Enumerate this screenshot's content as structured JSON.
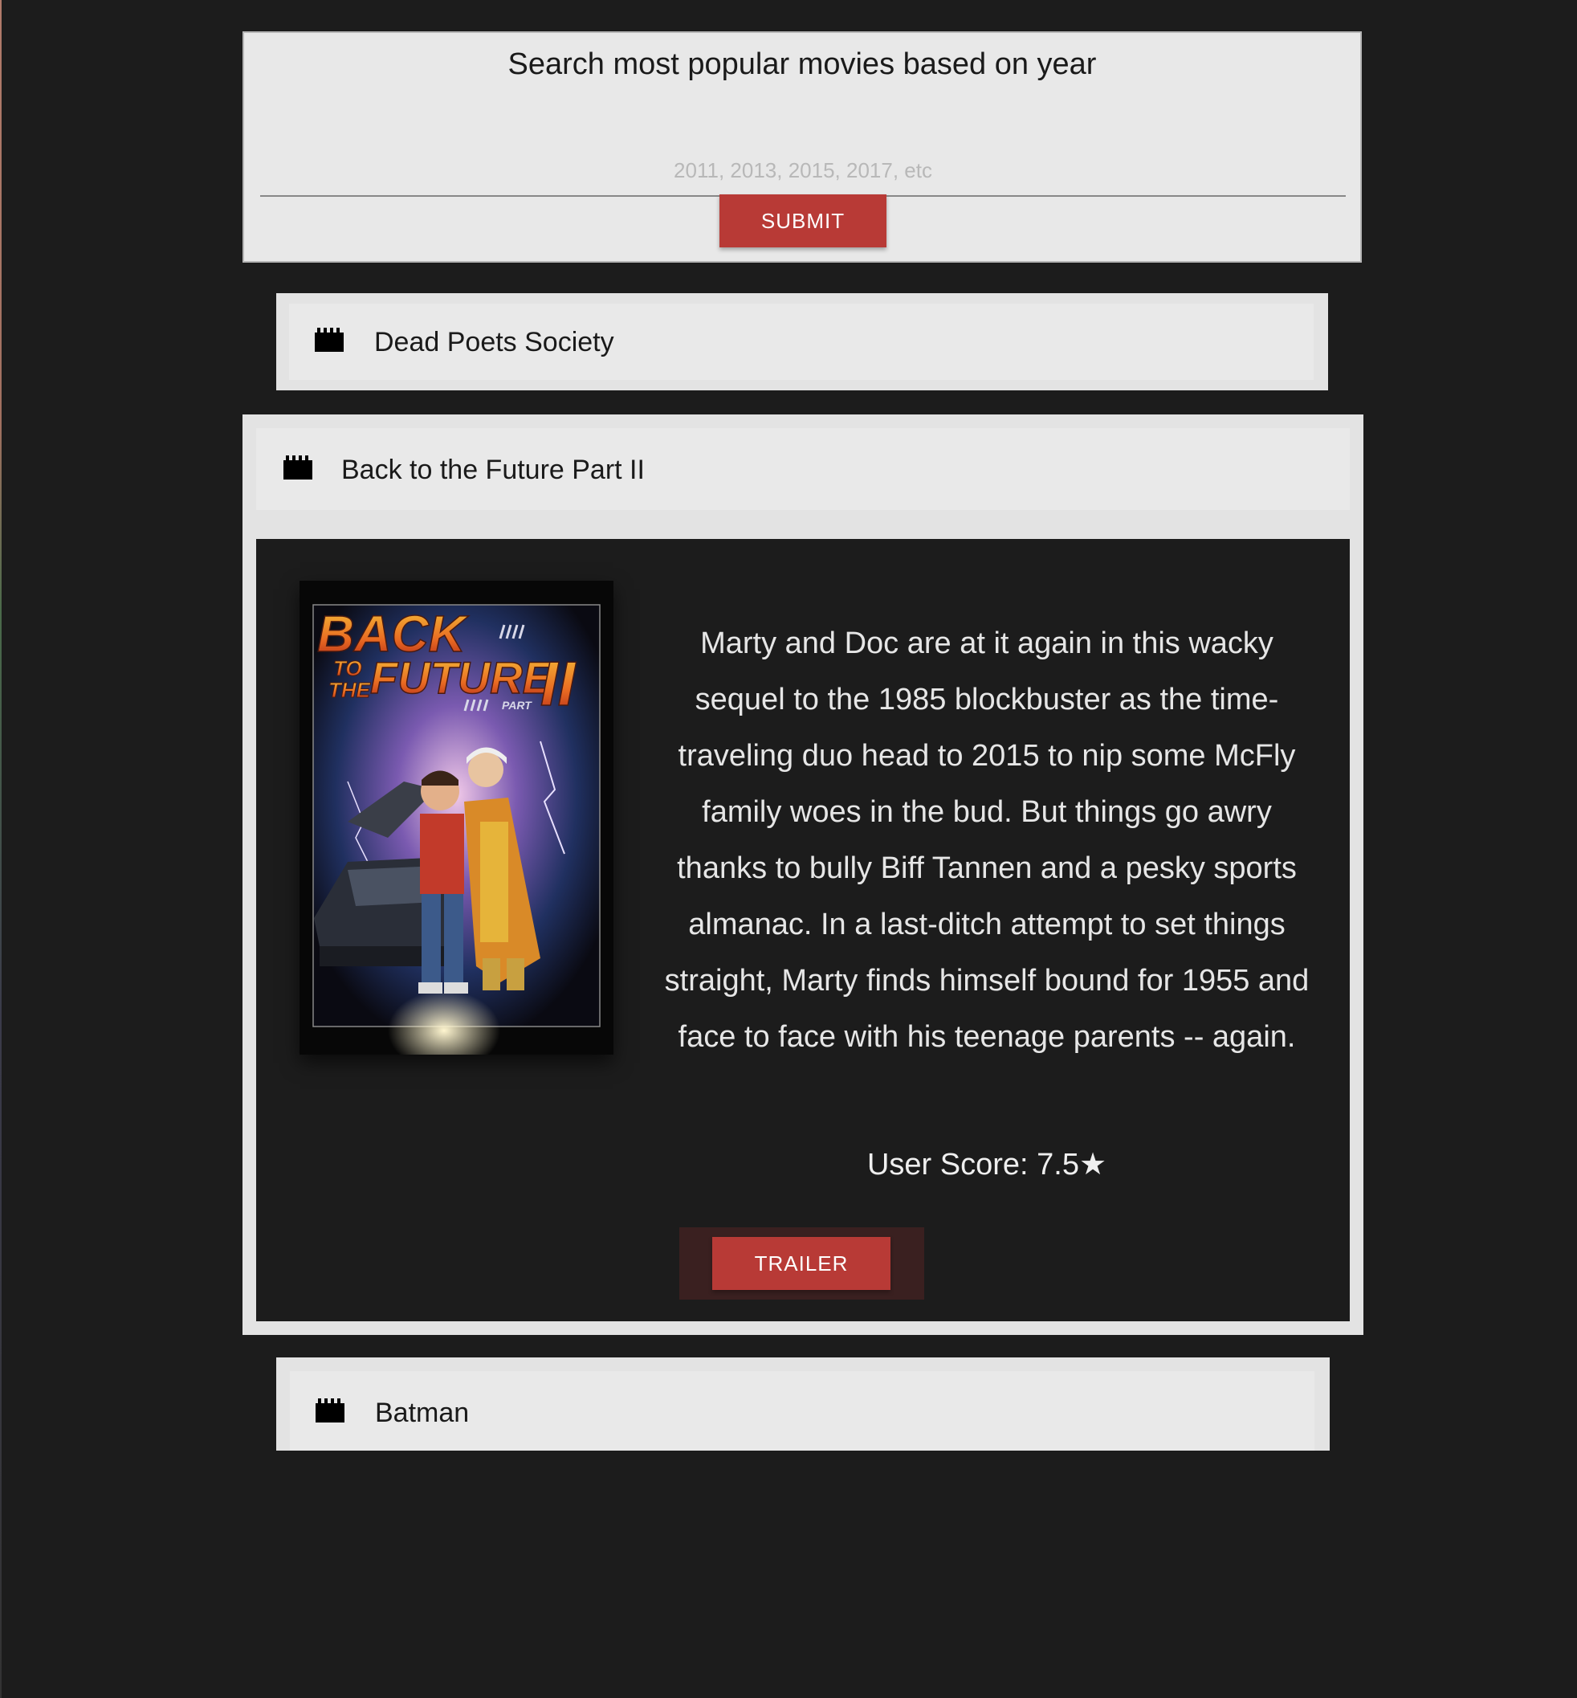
{
  "search": {
    "title": "Search most popular movies based on year",
    "placeholder": "2011, 2013, 2015, 2017, etc",
    "value": "",
    "submit_label": "SUBMIT"
  },
  "movies": [
    {
      "title": "Dead Poets Society",
      "icon": "clapperboard-icon",
      "expanded": false
    },
    {
      "title": "Back to the Future Part II",
      "icon": "clapperboard-icon",
      "expanded": true,
      "overview": "Marty and Doc are at it again in this wacky sequel to the 1985 blockbuster as the time-traveling duo head to 2015 to nip some McFly family woes in the bud. But things go awry thanks to bully Biff Tannen and a pesky sports almanac. In a last-ditch attempt to set things straight, Marty finds himself bound for 1955 and face to face with his teenage parents -- again.",
      "score_text": "User Score: 7.5★",
      "trailer_label": "TRAILER",
      "poster": {
        "line1": "BACK",
        "line2a": "TO",
        "line2b": "THE",
        "line2c": "FUTURE",
        "numeral": "II",
        "part": "PART"
      }
    },
    {
      "title": "Batman",
      "icon": "clapperboard-icon",
      "expanded": false
    }
  ],
  "colors": {
    "page_background": "#1c1c1c",
    "card_background": "#e8e8e8",
    "button_red": "#b83a36"
  }
}
